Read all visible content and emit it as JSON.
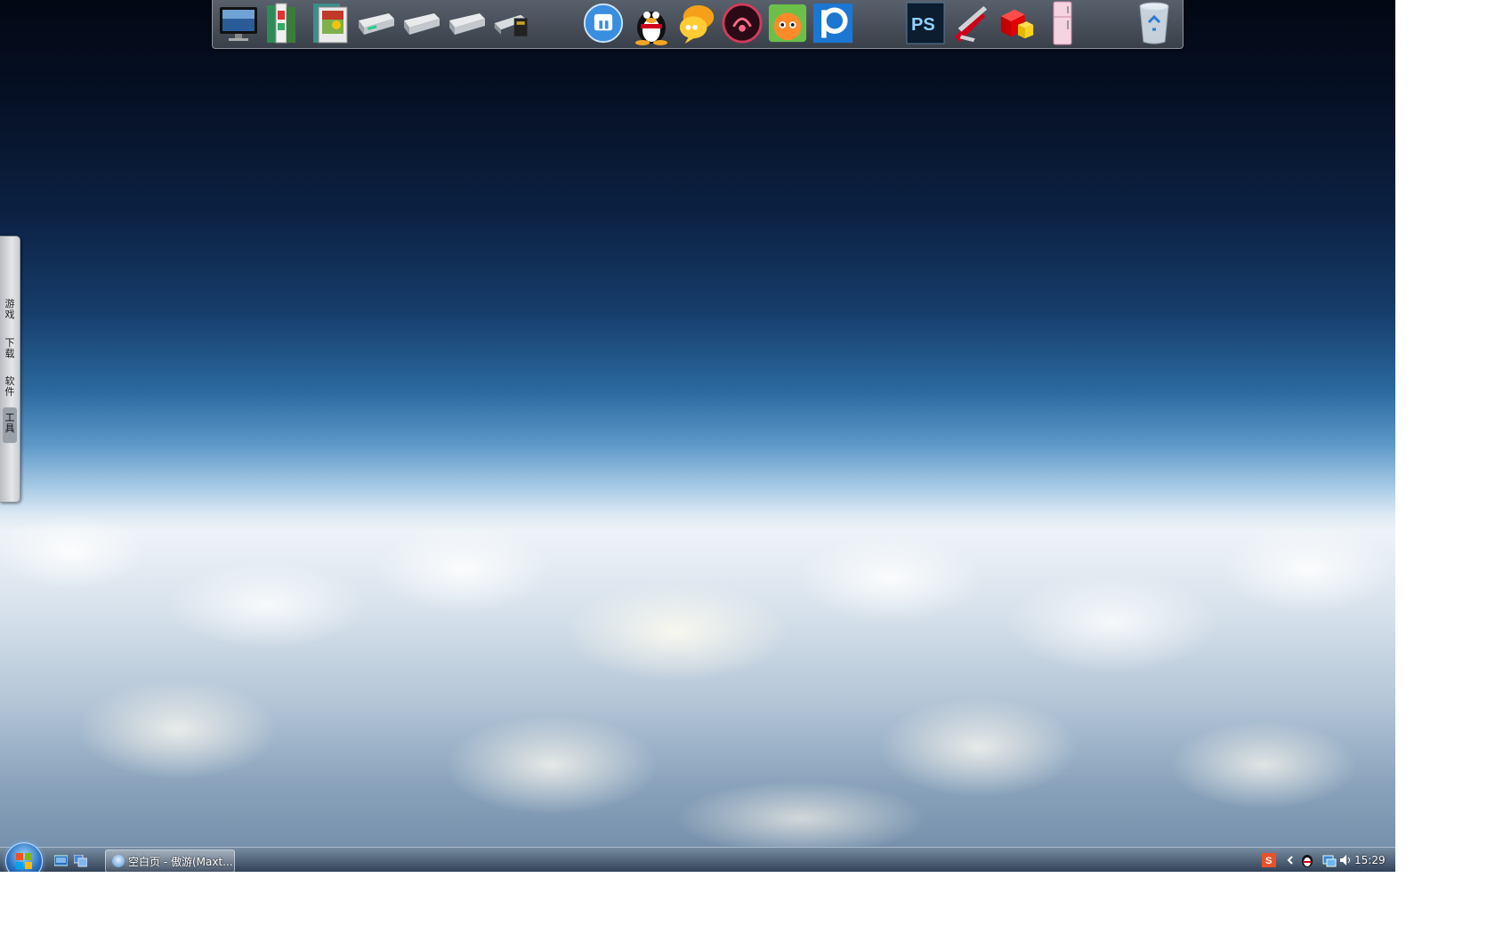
{
  "dock": {
    "icons": [
      {
        "name": "computer-monitor-icon"
      },
      {
        "name": "library-books-icon"
      },
      {
        "name": "photo-gallery-icon"
      },
      {
        "name": "drive-c-icon"
      },
      {
        "name": "drive-d-icon"
      },
      {
        "name": "drive-e-icon"
      },
      {
        "name": "usb-drive-icon"
      },
      {
        "name": "maxthon-browser-icon"
      },
      {
        "name": "qq-penguin-icon"
      },
      {
        "name": "chat-bubble-icon"
      },
      {
        "name": "music-player-icon"
      },
      {
        "name": "pps-player-icon"
      },
      {
        "name": "pptv-player-icon"
      },
      {
        "name": "photoshop-icon",
        "text": "PS"
      },
      {
        "name": "swiss-knife-icon"
      },
      {
        "name": "security-cubes-icon"
      },
      {
        "name": "fridge-icon"
      },
      {
        "name": "recycle-bin-icon"
      }
    ]
  },
  "sidepanel": {
    "tabs": [
      {
        "label": "游戏"
      },
      {
        "label": "下载"
      },
      {
        "label": "软件"
      },
      {
        "label": "工具"
      }
    ]
  },
  "taskbar": {
    "task_button_label": "空白页 - 傲游(Maxt...",
    "clock": "15:29"
  },
  "colors": {
    "dock_bg": "#3a4049",
    "sky_top": "#020814",
    "sky_horizon": "#dbe9f4"
  }
}
